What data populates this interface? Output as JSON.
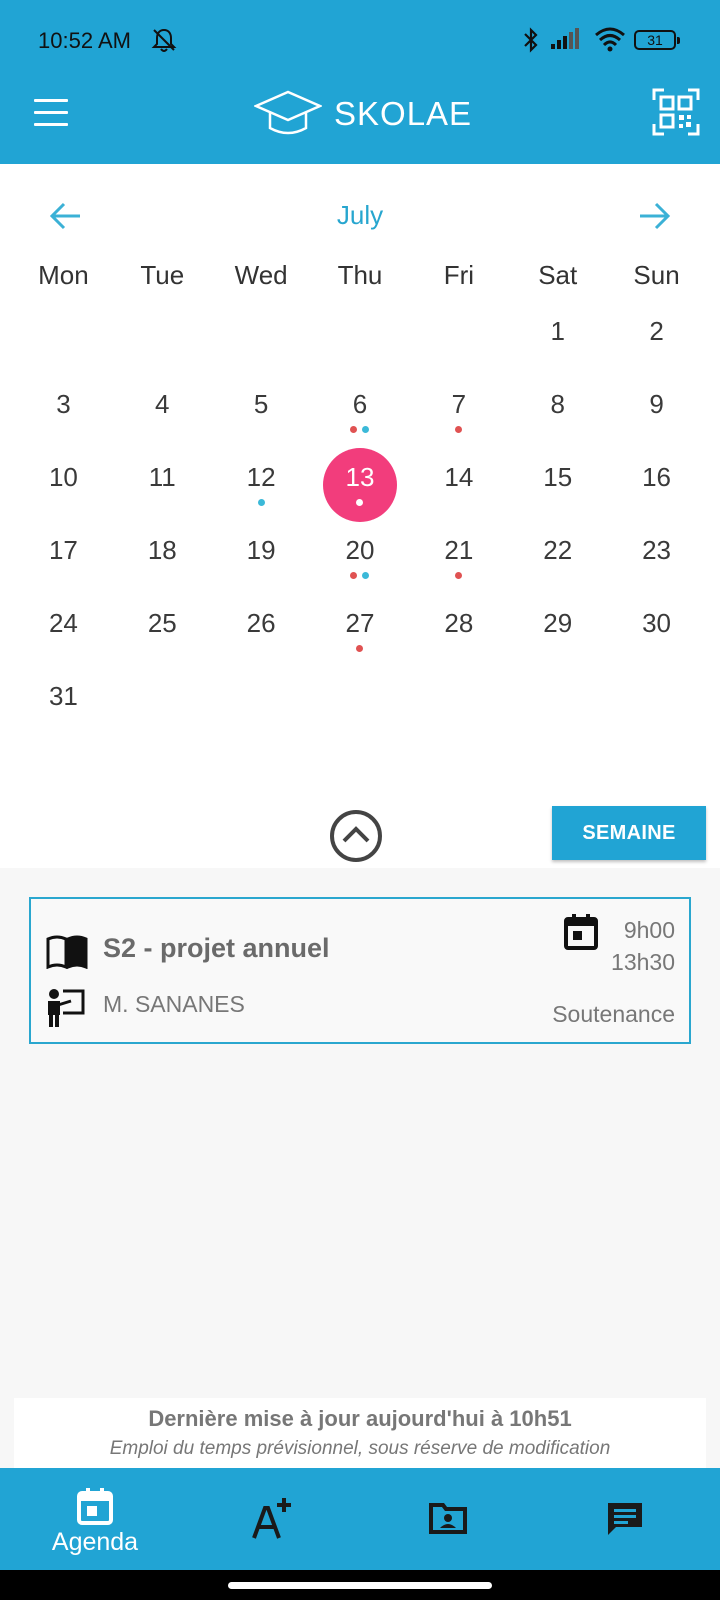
{
  "status_bar": {
    "time": "10:52 AM",
    "battery": "31",
    "icons": [
      "mute-bell-icon",
      "bluetooth-icon",
      "signal-icon",
      "wifi-icon",
      "battery-icon"
    ]
  },
  "app_bar": {
    "brand": "SKOLAE",
    "menu_icon": "hamburger-menu-icon",
    "qr_icon": "qr-code-icon"
  },
  "calendar": {
    "month": "July",
    "weekdays": [
      "Mon",
      "Tue",
      "Wed",
      "Thu",
      "Fri",
      "Sat",
      "Sun"
    ],
    "leading_blanks": 5,
    "days": [
      {
        "d": "1",
        "dots": []
      },
      {
        "d": "2",
        "dots": []
      },
      {
        "d": "3",
        "dots": []
      },
      {
        "d": "4",
        "dots": []
      },
      {
        "d": "5",
        "dots": []
      },
      {
        "d": "6",
        "dots": [
          "red",
          "blue"
        ]
      },
      {
        "d": "7",
        "dots": [
          "red"
        ]
      },
      {
        "d": "8",
        "dots": []
      },
      {
        "d": "9",
        "dots": []
      },
      {
        "d": "10",
        "dots": []
      },
      {
        "d": "11",
        "dots": []
      },
      {
        "d": "12",
        "dots": [
          "blue"
        ]
      },
      {
        "d": "13",
        "dots": [
          "white"
        ],
        "today": true
      },
      {
        "d": "14",
        "dots": []
      },
      {
        "d": "15",
        "dots": []
      },
      {
        "d": "16",
        "dots": []
      },
      {
        "d": "17",
        "dots": []
      },
      {
        "d": "18",
        "dots": []
      },
      {
        "d": "19",
        "dots": []
      },
      {
        "d": "20",
        "dots": [
          "red",
          "blue"
        ]
      },
      {
        "d": "21",
        "dots": [
          "red"
        ]
      },
      {
        "d": "22",
        "dots": []
      },
      {
        "d": "23",
        "dots": []
      },
      {
        "d": "24",
        "dots": []
      },
      {
        "d": "25",
        "dots": []
      },
      {
        "d": "26",
        "dots": []
      },
      {
        "d": "27",
        "dots": [
          "red"
        ]
      },
      {
        "d": "28",
        "dots": []
      },
      {
        "d": "29",
        "dots": []
      },
      {
        "d": "30",
        "dots": []
      },
      {
        "d": "31",
        "dots": []
      }
    ],
    "colors": {
      "accent": "#21a4d4",
      "today": "#f23d7c",
      "dot_red": "#e05252",
      "dot_blue": "#3bb9d8"
    }
  },
  "controls": {
    "week_button": "SEMAINE"
  },
  "event": {
    "title": "S2 - projet annuel",
    "teacher": "M. SANANES",
    "start": "9h00",
    "end": "13h30",
    "type": "Soutenance"
  },
  "footer": {
    "updated": "Dernière mise à jour aujourd'hui à 10h51",
    "disclaimer": "Emploi du temps prévisionnel, sous réserve de modification"
  },
  "bottom_nav": {
    "items": [
      {
        "label": "Agenda",
        "icon": "calendar-icon"
      },
      {
        "label": "",
        "icon": "grades-icon"
      },
      {
        "label": "",
        "icon": "documents-folder-icon"
      },
      {
        "label": "",
        "icon": "messages-icon"
      }
    ]
  }
}
